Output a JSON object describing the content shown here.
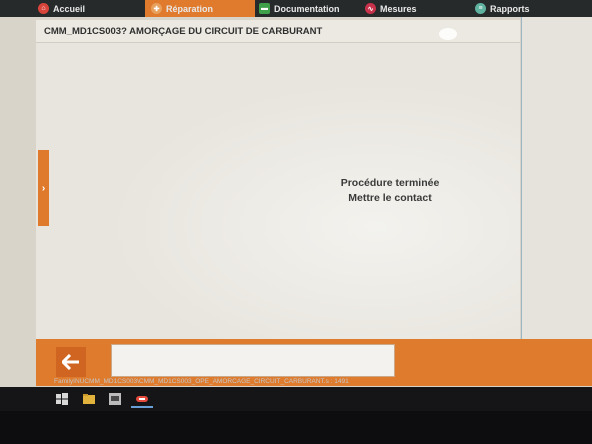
{
  "tabs": [
    {
      "label": "Accueil",
      "icon": "home-icon"
    },
    {
      "label": "Réparation",
      "icon": "wrench-icon"
    },
    {
      "label": "Documentation",
      "icon": "folder-icon"
    },
    {
      "label": "Mesures",
      "icon": "waveform-icon"
    },
    {
      "label": "Rapports",
      "icon": "report-icon"
    }
  ],
  "window": {
    "title": "CMM_MD1CS003? AMORÇAGE DU CIRCUIT DE CARBURANT"
  },
  "content": {
    "line1": "Procédure terminée",
    "line2": "Mettre le contact"
  },
  "footer": {
    "path": "FamilyINUCMM_MD1CS003\\CMM_MD1CS003_OPE_AMORCAGE_CIRCUIT_CARBURANT.s : 1491"
  },
  "colors": {
    "accent": "#e07a2c",
    "tabbar": "#262a2b",
    "background": "#e8e5de"
  }
}
